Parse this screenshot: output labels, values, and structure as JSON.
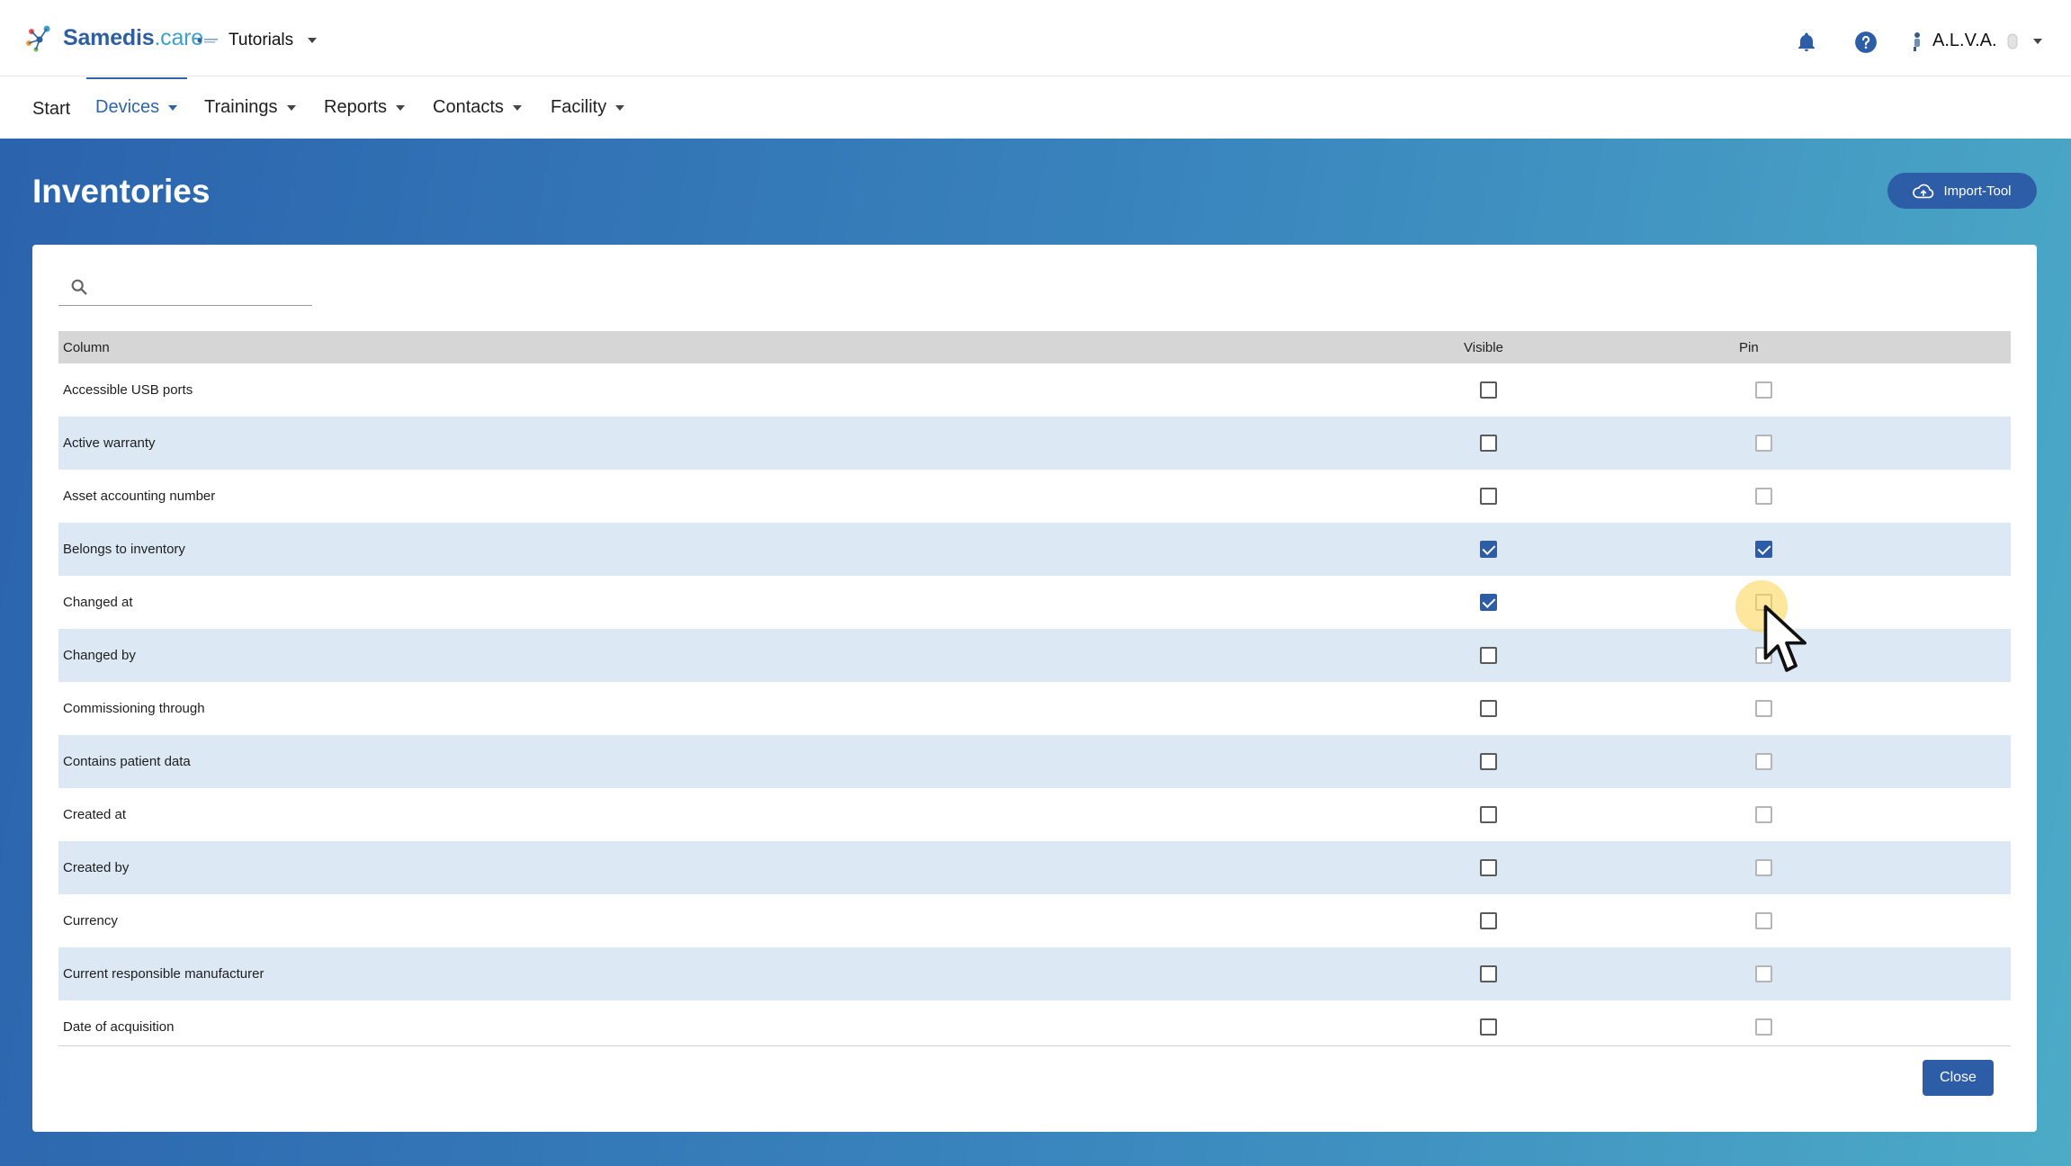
{
  "header": {
    "brand": "Samedis",
    "brand_suffix": ".care",
    "tenant": "Tutorials",
    "user": "A.L.V.A."
  },
  "nav": {
    "items": [
      {
        "label": "Start",
        "active": false,
        "dropdown": false
      },
      {
        "label": "Devices",
        "active": true,
        "dropdown": true
      },
      {
        "label": "Trainings",
        "active": false,
        "dropdown": true
      },
      {
        "label": "Reports",
        "active": false,
        "dropdown": true
      },
      {
        "label": "Contacts",
        "active": false,
        "dropdown": true
      },
      {
        "label": "Facility",
        "active": false,
        "dropdown": true
      }
    ]
  },
  "page": {
    "title": "Inventories",
    "import_label": "Import-Tool"
  },
  "search": {
    "placeholder": "",
    "value": ""
  },
  "table": {
    "headers": {
      "column": "Column",
      "visible": "Visible",
      "pin": "Pin"
    },
    "rows": [
      {
        "label": "Accessible USB ports",
        "visible": false,
        "pin": false
      },
      {
        "label": "Active warranty",
        "visible": false,
        "pin": false
      },
      {
        "label": "Asset accounting number",
        "visible": false,
        "pin": false
      },
      {
        "label": "Belongs to inventory",
        "visible": true,
        "pin": true
      },
      {
        "label": "Changed at",
        "visible": true,
        "pin": false
      },
      {
        "label": "Changed by",
        "visible": false,
        "pin": false
      },
      {
        "label": "Commissioning through",
        "visible": false,
        "pin": false
      },
      {
        "label": "Contains patient data",
        "visible": false,
        "pin": false
      },
      {
        "label": "Created at",
        "visible": false,
        "pin": false
      },
      {
        "label": "Created by",
        "visible": false,
        "pin": false
      },
      {
        "label": "Currency",
        "visible": false,
        "pin": false
      },
      {
        "label": "Current responsible manufacturer",
        "visible": false,
        "pin": false
      },
      {
        "label": "Date of acquisition",
        "visible": false,
        "pin": false
      }
    ]
  },
  "footer": {
    "close_label": "Close"
  },
  "colors": {
    "primary": "#2d5da7",
    "row_alt": "#dce9f5",
    "header_bg": "#d6d6d6"
  }
}
